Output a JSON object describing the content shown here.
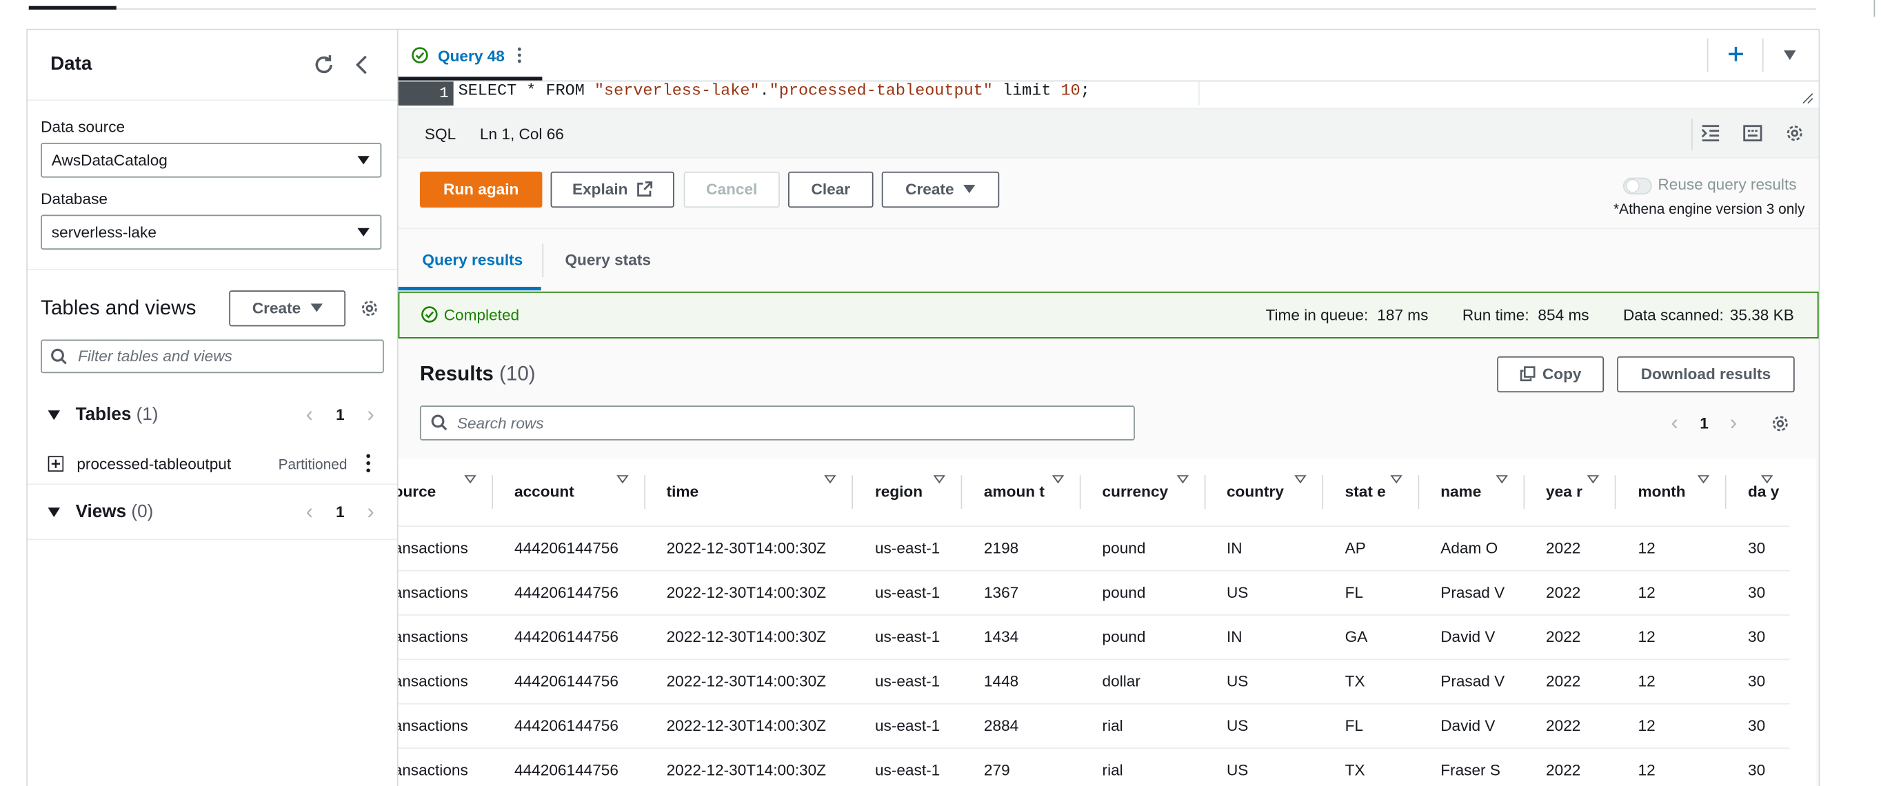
{
  "left_panel": {
    "title": "Data",
    "data_source_label": "Data source",
    "data_source_value": "AwsDataCatalog",
    "database_label": "Database",
    "database_value": "serverless-lake",
    "tables_and_views_title": "Tables and views",
    "create_label": "Create",
    "filter_placeholder": "Filter tables and views",
    "tables_group": {
      "label": "Tables",
      "count": "(1)",
      "page": "1"
    },
    "table_item": {
      "name": "processed-tableoutput",
      "badge": "Partitioned"
    },
    "views_group": {
      "label": "Views",
      "count": "(0)",
      "page": "1"
    }
  },
  "editor": {
    "tab_label": "Query 48",
    "line_number": "1",
    "sql_kw_select": "SELECT",
    "sql_star": " * ",
    "sql_kw_from": "FROM",
    "sql_db": " \"serverless-lake\"",
    "sql_dot": ".",
    "sql_table": "\"processed-tableoutput\"",
    "sql_limit": " limit ",
    "sql_limit_num": "10",
    "sql_end": ";",
    "language": "SQL",
    "cursor_position": "Ln 1, Col 66"
  },
  "toolbar": {
    "run_again": "Run again",
    "explain": "Explain",
    "cancel": "Cancel",
    "clear": "Clear",
    "create": "Create",
    "reuse_results": "Reuse query results",
    "engine_note": "*Athena engine version 3 only"
  },
  "result_tabs": {
    "results": "Query results",
    "stats": "Query stats"
  },
  "status": {
    "state": "Completed",
    "queue_label": "Time in queue:",
    "queue_value": "187 ms",
    "run_label": "Run time:",
    "run_value": "854 ms",
    "scanned_label": "Data scanned:",
    "scanned_value": "35.38 KB"
  },
  "results": {
    "title": "Results",
    "count": "(10)",
    "copy": "Copy",
    "download": "Download results",
    "search_placeholder": "Search rows",
    "page": "1"
  },
  "table": {
    "columns": [
      "ource",
      "account",
      "time",
      "region",
      "amoun t",
      "currency",
      "country",
      "stat e",
      "name",
      "yea r",
      "month",
      "da y"
    ],
    "rows": [
      [
        "ansactions",
        "444206144756",
        "2022-12-30T14:00:30Z",
        "us-east-1",
        "2198",
        "pound",
        "IN",
        "AP",
        "Adam O",
        "2022",
        "12",
        "30"
      ],
      [
        "ansactions",
        "444206144756",
        "2022-12-30T14:00:30Z",
        "us-east-1",
        "1367",
        "pound",
        "US",
        "FL",
        "Prasad V",
        "2022",
        "12",
        "30"
      ],
      [
        "ansactions",
        "444206144756",
        "2022-12-30T14:00:30Z",
        "us-east-1",
        "1434",
        "pound",
        "IN",
        "GA",
        "David V",
        "2022",
        "12",
        "30"
      ],
      [
        "ansactions",
        "444206144756",
        "2022-12-30T14:00:30Z",
        "us-east-1",
        "1448",
        "dollar",
        "US",
        "TX",
        "Prasad V",
        "2022",
        "12",
        "30"
      ],
      [
        "ansactions",
        "444206144756",
        "2022-12-30T14:00:30Z",
        "us-east-1",
        "2884",
        "rial",
        "US",
        "FL",
        "David V",
        "2022",
        "12",
        "30"
      ],
      [
        "ansactions",
        "444206144756",
        "2022-12-30T14:00:30Z",
        "us-east-1",
        "279",
        "rial",
        "US",
        "TX",
        "Fraser S",
        "2022",
        "12",
        "30"
      ]
    ]
  },
  "colors": {
    "primary_button": "#ec7211",
    "link_blue": "#0073bb",
    "success_green": "#1d8102",
    "border": "#d5dbdb"
  }
}
